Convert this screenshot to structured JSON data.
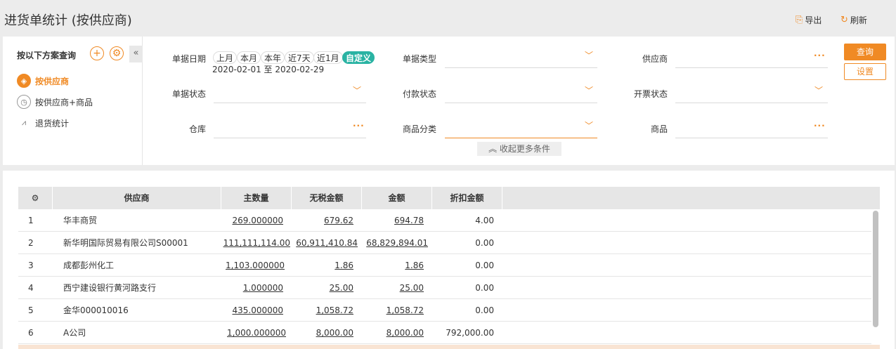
{
  "header": {
    "title": "进货单统计 (按供应商)",
    "export_label": "导出",
    "refresh_label": "刷新"
  },
  "scheme": {
    "title": "按以下方案查询",
    "add_icon": "plus-circle-icon",
    "settings_icon": "gear-circle-icon",
    "collapse_icon": "double-chevron-left-icon",
    "items": [
      {
        "label": "按供应商",
        "icon": "cube-icon",
        "active": true
      },
      {
        "label": "按供应商+商品",
        "icon": "clock-icon",
        "active": false
      },
      {
        "label": "退货统计",
        "icon": "chart-icon",
        "active": false
      }
    ]
  },
  "filters": {
    "doc_date_label": "单据日期",
    "date_chips": [
      "上月",
      "本月",
      "本年",
      "近7天",
      "近1月",
      "自定义"
    ],
    "date_range": "2020-02-01 至 2020-02-29",
    "doc_type_label": "单据类型",
    "supplier_label": "供应商",
    "doc_status_label": "单据状态",
    "payment_status_label": "付款状态",
    "invoice_status_label": "开票状态",
    "warehouse_label": "仓库",
    "category_label": "商品分类",
    "product_label": "商品",
    "more_toggle_label": "收起更多条件",
    "query_label": "查询",
    "settings_label": "设置"
  },
  "table": {
    "columns": [
      "供应商",
      "主数量",
      "无税金额",
      "金额",
      "折扣金额"
    ],
    "rows": [
      {
        "idx": "1",
        "supplier": "华丰商贸",
        "qty": "269.000000",
        "net": "679.62",
        "amount": "694.78",
        "discount": "4.00"
      },
      {
        "idx": "2",
        "supplier": "新华明国际贸易有限公司S00001",
        "qty": "111,111,114.00",
        "net": "60,911,410.84",
        "amount": "68,829,894.01",
        "discount": "0.00"
      },
      {
        "idx": "3",
        "supplier": "成都彭州化工",
        "qty": "1,103.000000",
        "net": "1.86",
        "amount": "1.86",
        "discount": "0.00"
      },
      {
        "idx": "4",
        "supplier": "西宁建设银行黄河路支行",
        "qty": "1.000000",
        "net": "25.00",
        "amount": "25.00",
        "discount": "0.00"
      },
      {
        "idx": "5",
        "supplier": "金华000010016",
        "qty": "435.000000",
        "net": "1,058.72",
        "amount": "1,058.72",
        "discount": "0.00"
      },
      {
        "idx": "6",
        "supplier": "A公司",
        "qty": "1,000.000000",
        "net": "8,000.00",
        "amount": "8,000.00",
        "discount": "792,000.00"
      }
    ]
  },
  "colors": {
    "accent": "#f08a24",
    "teal": "#2ab3a3"
  }
}
